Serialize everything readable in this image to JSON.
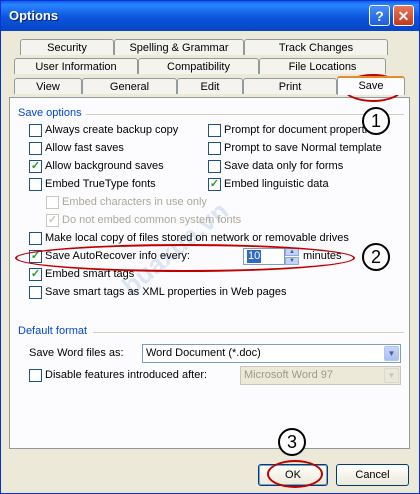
{
  "window": {
    "title": "Options",
    "help_glyph": "?",
    "close_glyph": "✕"
  },
  "tabs": {
    "row1": [
      "Security",
      "Spelling & Grammar",
      "Track Changes"
    ],
    "row2": [
      "User Information",
      "Compatibility",
      "File Locations"
    ],
    "row3": [
      "View",
      "General",
      "Edit",
      "Print",
      "Save"
    ],
    "active": "Save"
  },
  "save_options": {
    "title": "Save options",
    "left": [
      {
        "label": "Always create backup copy",
        "checked": false
      },
      {
        "label": "Allow fast saves",
        "checked": false
      },
      {
        "label": "Allow background saves",
        "checked": true
      },
      {
        "label": "Embed TrueType fonts",
        "checked": false
      }
    ],
    "right": [
      {
        "label": "Prompt for document properties",
        "checked": false
      },
      {
        "label": "Prompt to save Normal template",
        "checked": false
      },
      {
        "label": "Save data only for forms",
        "checked": false
      },
      {
        "label": "Embed linguistic data",
        "checked": true
      }
    ],
    "sub": [
      {
        "label": "Embed characters in use only",
        "checked": false,
        "disabled": true
      },
      {
        "label": "Do not embed common system fonts",
        "checked": true,
        "disabled": true
      }
    ],
    "make_local": {
      "label": "Make local copy of files stored on network or removable drives",
      "checked": false
    },
    "autorecover": {
      "label": "Save AutoRecover info every:",
      "checked": true,
      "value": "10",
      "unit": "minutes"
    },
    "smart_tags": {
      "label": "Embed smart tags",
      "checked": true
    },
    "xml": {
      "label": "Save smart tags as XML properties in Web pages",
      "checked": false
    }
  },
  "default_format": {
    "title": "Default format",
    "save_as_label": "Save Word files as:",
    "save_as_value": "Word Document (*.doc)",
    "disable_label": "Disable features introduced after:",
    "disable_checked": false,
    "disable_value": "Microsoft Word 97"
  },
  "buttons": {
    "ok": "OK",
    "cancel": "Cancel"
  },
  "annotations": {
    "m1": "1",
    "m2": "2",
    "m3": "3",
    "highlight_color": "#c00000"
  },
  "watermark": "buaxua.vn",
  "icons": {
    "checkmark": "✓",
    "dropdown": "▼",
    "spin_up": "▲",
    "spin_down": "▼"
  }
}
